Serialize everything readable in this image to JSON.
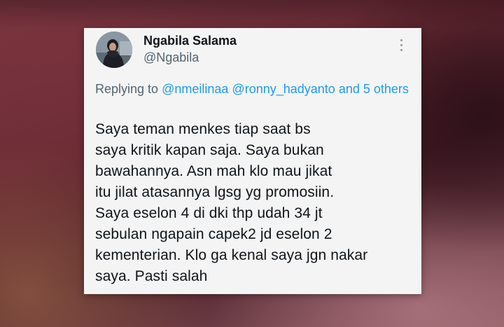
{
  "tweet": {
    "author": {
      "display_name": "Ngabila Salama",
      "handle": "@Ngabila"
    },
    "replying": {
      "prefix": "Replying to",
      "mentions": [
        "@nmeilinaa",
        "@ronny_hadyanto"
      ],
      "conjunction": "and",
      "others": "5 others"
    },
    "body_lines": [
      "Saya teman menkes tiap saat bs",
      "saya kritik kapan saja. Saya bukan",
      "bawahannya. Asn mah klo mau jikat",
      "itu jilat atasannya lgsg yg promosiin.",
      "Saya eselon 4 di dki thp udah 34 jt",
      "sebulan ngapain capek2 jd eselon 2",
      "kementerian. Klo ga kenal saya jgn nakar",
      "saya. Pasti salah"
    ]
  },
  "icons": {
    "more": "more-vertical-icon",
    "avatar": "profile-photo"
  },
  "colors": {
    "card_background": "#f4f4f4",
    "name_text": "#0f1419",
    "secondary_text": "#536471",
    "link": "#1d9bf0"
  }
}
